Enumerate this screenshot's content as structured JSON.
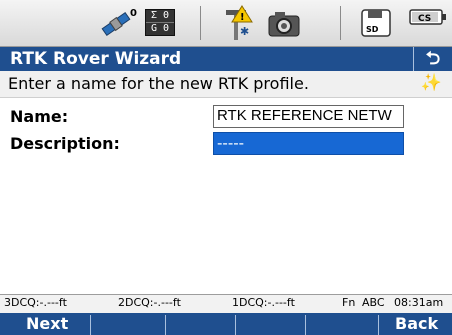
{
  "status_bar": {
    "icons": [
      "satellite-icon",
      "antenna-warning-icon",
      "camera-icon",
      "sd-card-icon",
      "cs-battery-icon"
    ],
    "sat_counts": [
      "Σ 0",
      "G 0"
    ],
    "satellite_badge": "0",
    "sd_label": "SD",
    "cs_label": "CS"
  },
  "title_bar": {
    "title": "RTK Rover Wizard",
    "back_symbol": "⮌"
  },
  "prompt": {
    "text": "Enter a name for the new RTK profile."
  },
  "form": {
    "name_label": "Name:",
    "name_value": "RTK REFERENCE NETW",
    "description_label": "Description:",
    "description_value": "-----"
  },
  "quality_line": {
    "dcq3": "3DCQ:-.---ft",
    "dcq2": "2DCQ:-.---ft",
    "dcq1": "1DCQ:-.---ft",
    "fn_indicator": "Fn",
    "input_mode": "ABC",
    "time": "08:31am"
  },
  "softkeys": {
    "f1": "Next",
    "f6": "Back"
  }
}
